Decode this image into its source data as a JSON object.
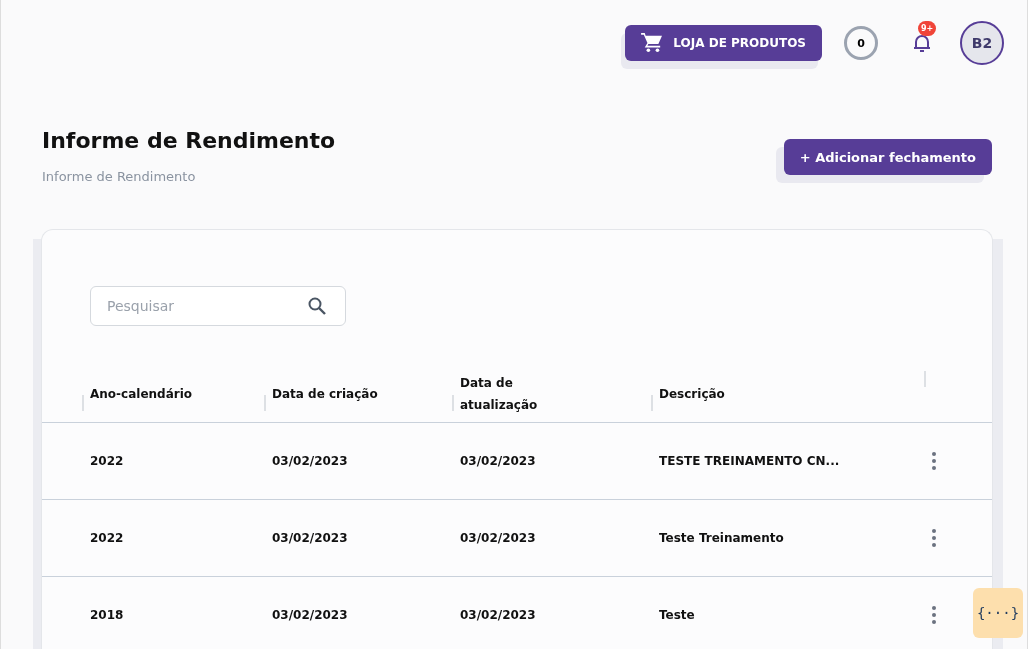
{
  "header": {
    "store_button": "LOJA DE PRODUTOS",
    "counter": "0",
    "notification_badge": "9+",
    "avatar": "B2"
  },
  "page": {
    "title": "Informe de Rendimento",
    "breadcrumb": "Informe de Rendimento",
    "add_button": "+ Adicionar fechamento"
  },
  "search": {
    "placeholder": "Pesquisar"
  },
  "table": {
    "columns": [
      "Ano-calendário",
      "Data de criação",
      "Data de atualização",
      "Descrição"
    ],
    "rows": [
      {
        "cells": [
          "2022",
          "03/02/2023",
          "03/02/2023",
          "TESTE TREINAMENTO CN..."
        ]
      },
      {
        "cells": [
          "2022",
          "03/02/2023",
          "03/02/2023",
          "Teste Treinamento"
        ]
      },
      {
        "cells": [
          "2018",
          "03/02/2023",
          "03/02/2023",
          "Teste"
        ]
      }
    ]
  },
  "floating_button": "{···}"
}
